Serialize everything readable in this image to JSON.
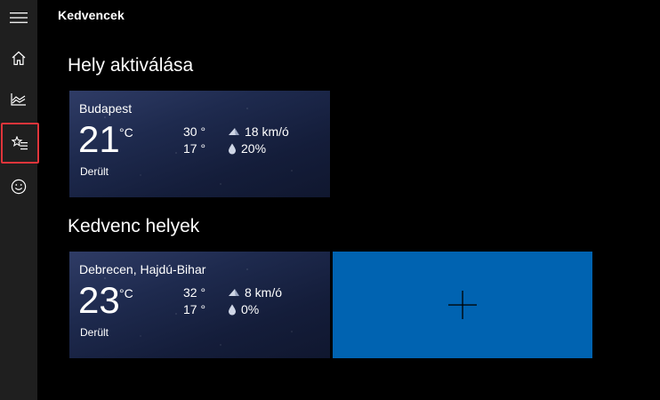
{
  "app": {
    "title": "Kedvencek"
  },
  "sidebar": {
    "items": [
      {
        "icon": "hamburger-menu-icon"
      },
      {
        "icon": "home-icon"
      },
      {
        "icon": "chart-icon"
      },
      {
        "icon": "favorites-list-icon",
        "selected": true
      },
      {
        "icon": "smiley-icon"
      }
    ],
    "selected_outline_color": "#e0353b"
  },
  "sections": {
    "location": {
      "title": "Hely aktiválása",
      "tile": {
        "city": "Budapest",
        "temp": "21",
        "unit": "°C",
        "condition": "Derült",
        "high": "30 °",
        "low": "17 °",
        "wind": "18 km/ó",
        "precip": "20%"
      }
    },
    "favorites": {
      "title": "Kedvenc helyek",
      "tile": {
        "city": "Debrecen, Hajdú-Bihar",
        "temp": "23",
        "unit": "°C",
        "condition": "Derült",
        "high": "32 °",
        "low": "17 °",
        "wind": "8 km/ó",
        "precip": "0%"
      },
      "add_tile": {
        "icon": "plus-icon",
        "color": "#0063b1"
      }
    }
  }
}
